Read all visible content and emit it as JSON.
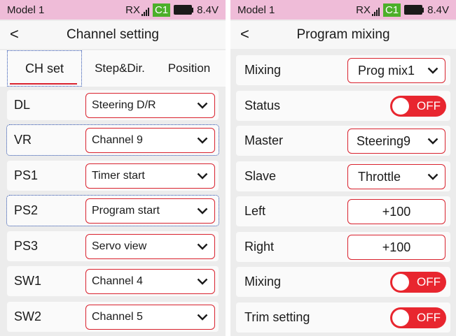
{
  "status_bar": {
    "model": "Model 1",
    "rx_label": "RX",
    "signal_bars": 4,
    "profile_badge": "C1",
    "voltage": "8.4V",
    "battery_icon": "battery-full-icon"
  },
  "colors": {
    "accent_red": "#d9222e",
    "status_bar_bg": "#efbcd8",
    "badge_green": "#4caf2a",
    "focus_outline": "#2a4fb0"
  },
  "channel_setting": {
    "title": "Channel setting",
    "tabs": [
      {
        "label": "CH set",
        "active": true
      },
      {
        "label": "Step&Dir.",
        "active": false
      },
      {
        "label": "Position",
        "active": false
      }
    ],
    "rows": [
      {
        "label": "DL",
        "value": "Steering D/R",
        "focused": false
      },
      {
        "label": "VR",
        "value": "Channel 9",
        "focused": true
      },
      {
        "label": "PS1",
        "value": "Timer start",
        "focused": false
      },
      {
        "label": "PS2",
        "value": "Program start",
        "focused": true
      },
      {
        "label": "PS3",
        "value": "Servo view",
        "focused": false
      },
      {
        "label": "SW1",
        "value": "Channel 4",
        "focused": false
      },
      {
        "label": "SW2",
        "value": "Channel 5",
        "focused": false
      }
    ]
  },
  "program_mixing": {
    "title": "Program mixing",
    "mixing_select": {
      "label": "Mixing",
      "value": "Prog mix1"
    },
    "status": {
      "label": "Status",
      "state": "OFF"
    },
    "master": {
      "label": "Master",
      "value": "Steering9"
    },
    "slave": {
      "label": "Slave",
      "value": "Throttle"
    },
    "left": {
      "label": "Left",
      "value": "+100"
    },
    "right": {
      "label": "Right",
      "value": "+100"
    },
    "mixing_toggle": {
      "label": "Mixing",
      "state": "OFF"
    },
    "trim_setting": {
      "label": "Trim setting",
      "state": "OFF"
    }
  }
}
